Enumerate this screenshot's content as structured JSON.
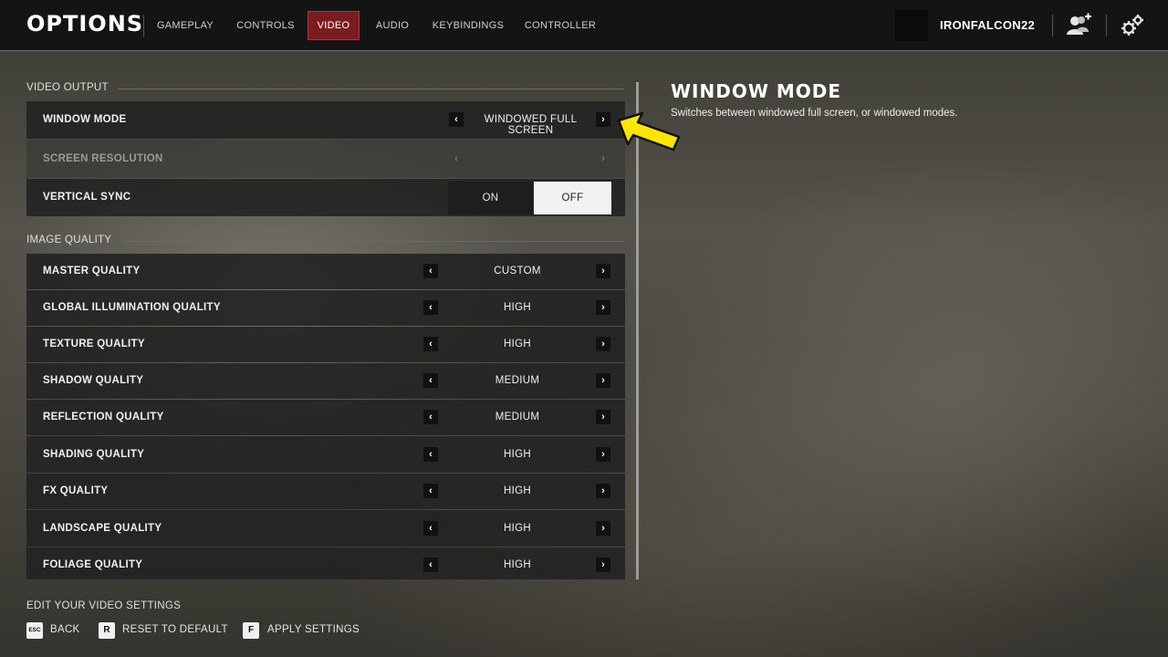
{
  "header": {
    "title": "OPTIONS",
    "tabs": [
      {
        "label": "GAMEPLAY",
        "active": false
      },
      {
        "label": "CONTROLS",
        "active": false
      },
      {
        "label": "VIDEO",
        "active": true
      },
      {
        "label": "AUDIO",
        "active": false
      },
      {
        "label": "KEYBINDINGS",
        "active": false
      },
      {
        "label": "CONTROLLER",
        "active": false
      }
    ],
    "username": "IRONFALCON22",
    "icons": [
      "friends-add-icon",
      "settings-gears-icon"
    ]
  },
  "video_output": {
    "heading": "VIDEO OUTPUT",
    "window_mode": {
      "label": "WINDOW MODE",
      "value": "WINDOWED FULL SCREEN"
    },
    "screen_resolution": {
      "label": "SCREEN RESOLUTION",
      "value": "",
      "disabled": true
    },
    "vertical_sync": {
      "label": "VERTICAL SYNC",
      "on_label": "ON",
      "off_label": "OFF",
      "selected": "OFF"
    }
  },
  "image_quality": {
    "heading": "IMAGE QUALITY",
    "rows": [
      {
        "label": "MASTER QUALITY",
        "value": "CUSTOM"
      },
      {
        "label": "GLOBAL ILLUMINATION QUALITY",
        "value": "HIGH"
      },
      {
        "label": "TEXTURE QUALITY",
        "value": "HIGH"
      },
      {
        "label": "SHADOW QUALITY",
        "value": "MEDIUM"
      },
      {
        "label": "REFLECTION QUALITY",
        "value": "MEDIUM"
      },
      {
        "label": "SHADING QUALITY",
        "value": "HIGH"
      },
      {
        "label": "FX QUALITY",
        "value": "HIGH"
      },
      {
        "label": "LANDSCAPE QUALITY",
        "value": "HIGH"
      },
      {
        "label": "FOLIAGE QUALITY",
        "value": "HIGH"
      }
    ]
  },
  "description": {
    "title": "WINDOW MODE",
    "text": "Switches between windowed full screen, or windowed modes."
  },
  "footer": {
    "hint": "EDIT YOUR VIDEO SETTINGS",
    "actions": [
      {
        "key": "ESC",
        "label": "BACK"
      },
      {
        "key": "R",
        "label": "RESET TO DEFAULT"
      },
      {
        "key": "F",
        "label": "APPLY SETTINGS"
      }
    ]
  },
  "colors": {
    "accent_tab": "#7a1b20",
    "pointer": "#ffe600"
  }
}
